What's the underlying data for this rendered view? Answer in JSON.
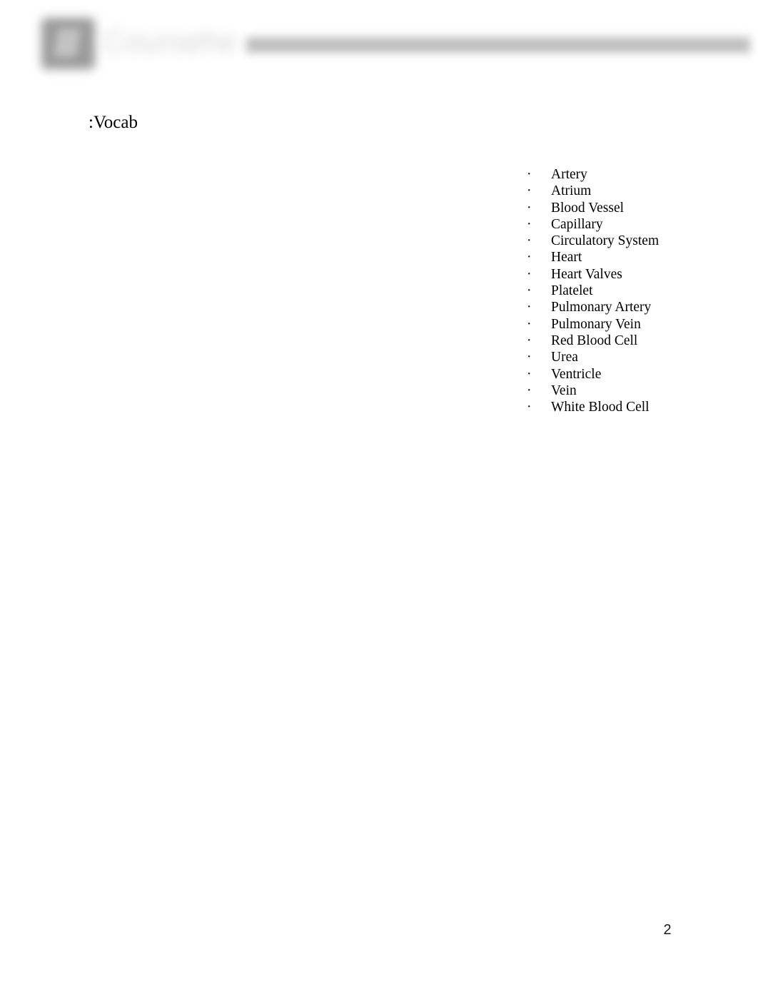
{
  "document": {
    "page_number": "2"
  },
  "header": {
    "logo_icon": "document-logo-icon",
    "wordmark_text": "Coursehero",
    "rule_label": ""
  },
  "body": {
    "section_title": ":Vocab"
  },
  "vocab": {
    "bullet_glyph": "·",
    "items": [
      {
        "label": "Artery"
      },
      {
        "label": "Atrium"
      },
      {
        "label": "Blood Vessel"
      },
      {
        "label": "Capillary"
      },
      {
        "label": "Circulatory System"
      },
      {
        "label": "Heart"
      },
      {
        "label": "Heart Valves"
      },
      {
        "label": "Platelet"
      },
      {
        "label": "Pulmonary Artery"
      },
      {
        "label": "Pulmonary Vein"
      },
      {
        "label": "Red Blood Cell"
      },
      {
        "label": "Urea"
      },
      {
        "label": "Ventricle"
      },
      {
        "label": "Vein"
      },
      {
        "label": "White Blood Cell"
      }
    ]
  },
  "colors": {
    "page_background": "#ffffff",
    "text": "#000000",
    "header_logo": "#9b9b9b",
    "header_rule": "#bfbfbf",
    "header_wordmark": "#d2d2d2"
  }
}
